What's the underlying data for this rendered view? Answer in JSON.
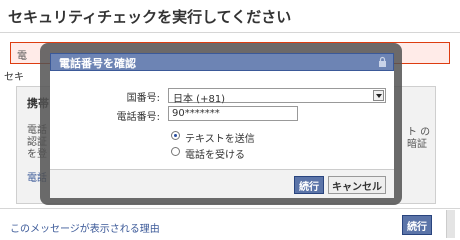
{
  "page": {
    "title": "セキュリティチェックを実行してください",
    "error_stub": "電",
    "security_stub": "セキ",
    "panel_heading": "携帯",
    "panel_lines": "電話\n認証\nを登",
    "panel_link": "電話",
    "panel_right": "ト の\n暗証",
    "reason_link": "このメッセージが表示される理由",
    "continue_label": "続行"
  },
  "dialog": {
    "title": "電話番号を確認",
    "country_label": "国番号:",
    "country_value": "日本 (+81)",
    "phone_label": "電話番号:",
    "phone_value": "90*******",
    "radio_sms": "テキストを送信",
    "radio_call": "電話を受ける",
    "continue_label": "続行",
    "cancel_label": "キャンセル"
  },
  "colors": {
    "header_blue": "#6d84b4",
    "button_blue": "#5b74a8",
    "error_bg": "#ffebe8",
    "error_border": "#dd3c10"
  }
}
